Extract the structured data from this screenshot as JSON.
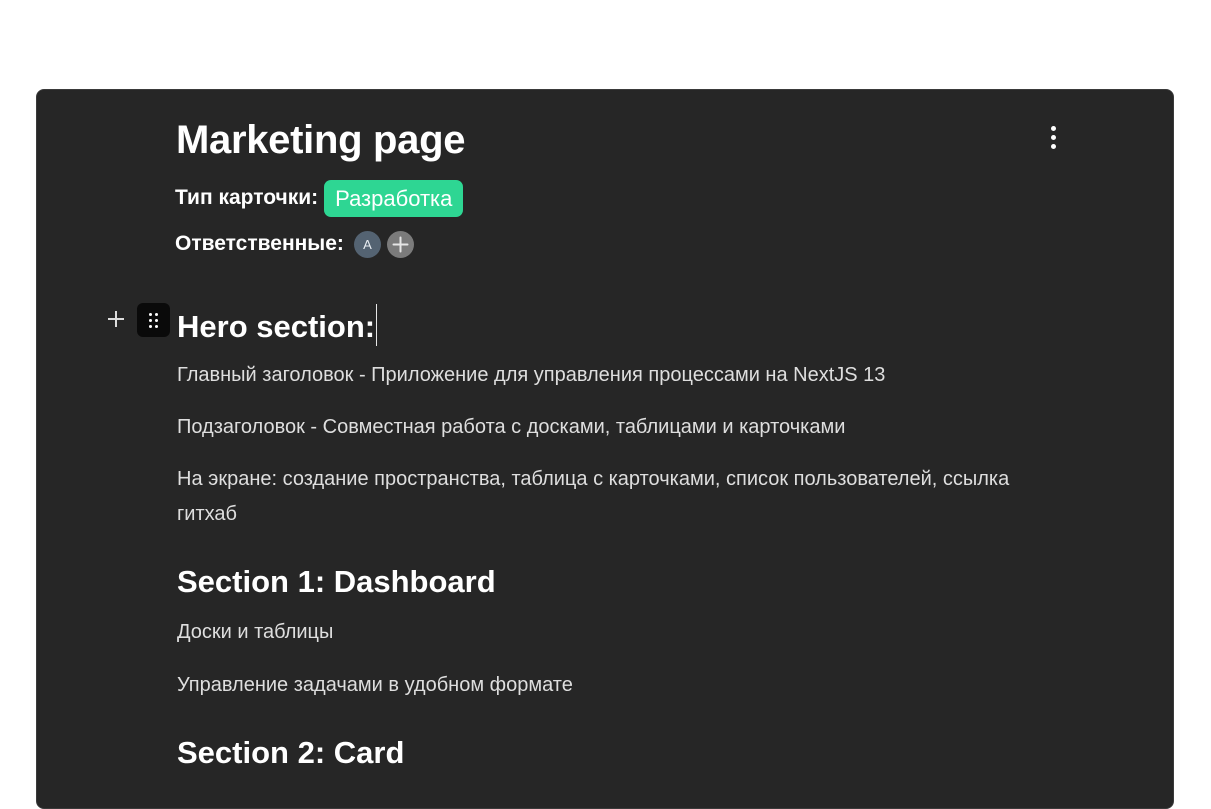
{
  "card": {
    "title": "Marketing page",
    "type_label": "Тип карточки:",
    "type_badge": "Разработка",
    "responsible_label": "Ответственные:",
    "avatar_initial": "A",
    "colors": {
      "card_bg": "#262626",
      "badge_bg": "#2ed693",
      "avatar_bg": "#546372",
      "add_button_bg": "#7b7b7b",
      "handle_bg": "#0a0a0a"
    }
  },
  "icons": {
    "menu": "more-vertical-icon",
    "add_responsible": "plus-icon",
    "block_add": "plus-icon",
    "drag": "drag-handle-icon"
  },
  "content": {
    "hero_heading": "Hero section:",
    "hero_paragraphs": [
      "Главный заголовок - Приложение для управления процессами на NextJS 13",
      "Подзаголовок - Совместная работа с досками, таблицами и карточками",
      "На экране: создание пространства, таблица с карточками, список пользователей, ссылка гитхаб"
    ],
    "section1_heading": "Section 1: Dashboard",
    "section1_paragraphs": [
      "Доски и таблицы",
      "Управление задачами в удобном формате"
    ],
    "section2_heading": "Section 2: Card"
  }
}
